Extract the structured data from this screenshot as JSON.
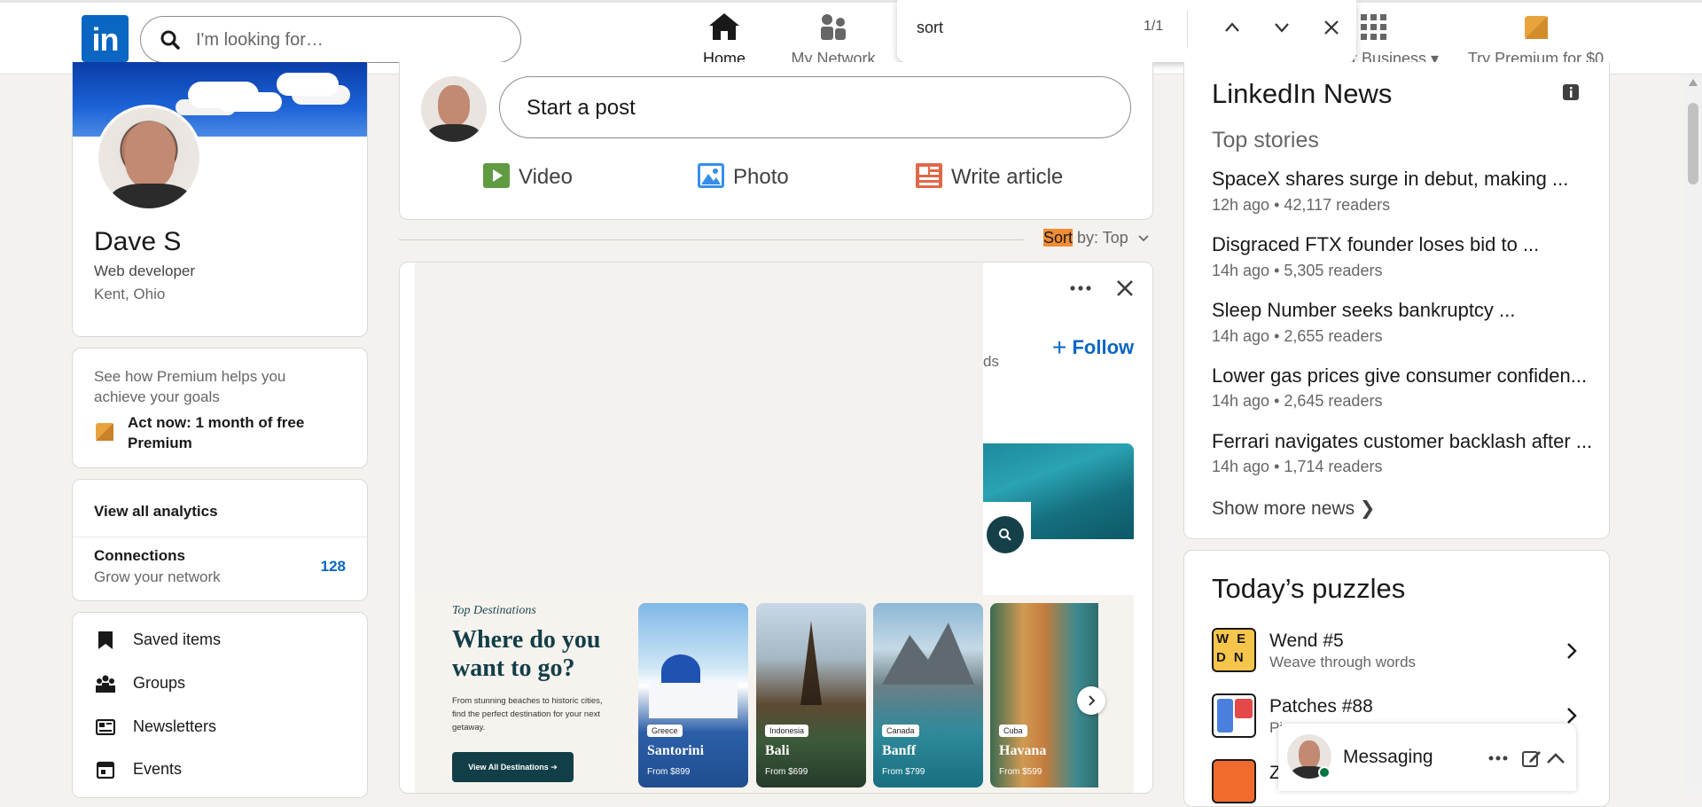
{
  "topbar": {
    "logo": "in",
    "search_placeholder": "I'm looking for…",
    "nav": [
      {
        "label": "Home"
      },
      {
        "label": "My Network"
      },
      {
        "label": "r Business"
      },
      {
        "label": "Try Premium for $0"
      }
    ],
    "partial_label": "g"
  },
  "find": {
    "query": "sort",
    "count": "1/1"
  },
  "profile": {
    "name": "Dave S",
    "headline": "Web developer",
    "location": "Kent, Ohio"
  },
  "premium": {
    "text": "See how Premium helps you achieve your goals",
    "cta": "Act now: 1 month of free Premium"
  },
  "analytics": {
    "view_all": "View all analytics",
    "connections_label": "Connections",
    "connections_sub": "Grow your network",
    "connections_count": "128"
  },
  "links": [
    {
      "label": "Saved items"
    },
    {
      "label": "Groups"
    },
    {
      "label": "Newsletters"
    },
    {
      "label": "Events"
    }
  ],
  "composer": {
    "placeholder": "Start a post",
    "video": "Video",
    "photo": "Photo",
    "article": "Write article"
  },
  "sort": {
    "highlight": "Sort",
    "rest": " by: Top"
  },
  "feed": {
    "follow": "Follow",
    "partial": "ds"
  },
  "ad": {
    "kicker": "Top Destinations",
    "title": "Where do you want to go?",
    "desc": "From stunning beaches to historic cities, find the perfect destination for your next getaway.",
    "button": "View All Destinations",
    "destinations": [
      {
        "country": "Greece",
        "name": "Santorini",
        "price": "From $899"
      },
      {
        "country": "Indonesia",
        "name": "Bali",
        "price": "From $699"
      },
      {
        "country": "Canada",
        "name": "Banff",
        "price": "From $799"
      },
      {
        "country": "Cuba",
        "name": "Havana",
        "price": "From $599"
      }
    ]
  },
  "news": {
    "title": "LinkedIn News",
    "subtitle": "Top stories",
    "items": [
      {
        "title": "SpaceX shares surge in debut, making ...",
        "meta": "12h ago • 42,117 readers"
      },
      {
        "title": "Disgraced FTX founder loses bid to ...",
        "meta": "14h ago • 5,305 readers"
      },
      {
        "title": "Sleep Number seeks bankruptcy ...",
        "meta": "14h ago • 2,655 readers"
      },
      {
        "title": "Lower gas prices give consumer confiden...",
        "meta": "14h ago • 2,645 readers"
      },
      {
        "title": "Ferrari navigates customer backlash after ...",
        "meta": "14h ago • 1,714 readers"
      }
    ],
    "show_more": "Show more news"
  },
  "puzzles": {
    "title": "Today’s puzzles",
    "items": [
      {
        "name": "Wend #5",
        "desc": "Weave through words"
      },
      {
        "name": "Patches #88",
        "desc": "Pi"
      }
    ],
    "third": "Z"
  },
  "messaging": {
    "label": "Messaging"
  },
  "colors": {
    "brand": "#0a66c2",
    "premium": "#e7a33e",
    "find_highlight": "#f28c37"
  }
}
